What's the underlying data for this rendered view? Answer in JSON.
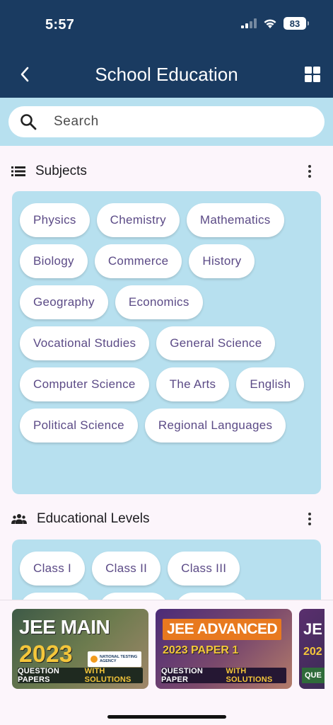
{
  "status_bar": {
    "time": "5:57",
    "battery": "83"
  },
  "header": {
    "title": "School Education",
    "back_icon": "chevron-left-icon",
    "grid_icon": "grid-icon"
  },
  "search": {
    "placeholder": "Search",
    "icon": "search-icon"
  },
  "subjects": {
    "title": "Subjects",
    "icon": "list-icon",
    "chips": [
      "Physics",
      "Chemistry",
      "Mathematics",
      "Biology",
      "Commerce",
      "History",
      "Geography",
      "Economics",
      "Vocational Studies",
      "General Science",
      "Computer Science",
      "The Arts",
      "English",
      "Political Science",
      "Regional Languages"
    ]
  },
  "educational_levels": {
    "title": "Educational Levels",
    "icon": "people-icon",
    "chips": [
      "Class I",
      "Class II",
      "Class III"
    ]
  },
  "banners": [
    {
      "title": "JEE MAIN",
      "year": "2023",
      "agency": "NATIONAL TESTING AGENCY",
      "footer": "QUESTION PAPERS",
      "footer_highlight": "WITH SOLUTIONS"
    },
    {
      "title": "JEE ADVANCED",
      "year": "2023 PAPER 1",
      "footer": "QUESTION PAPER",
      "footer_highlight": "WITH SOLUTIONS"
    },
    {
      "title": "JE",
      "year": "202",
      "footer": "QUE"
    }
  ],
  "colors": {
    "header": "#1a3b61",
    "panel": "#b7e0ef",
    "chip_text": "#5b4a86",
    "background": "#fcf5fb"
  }
}
